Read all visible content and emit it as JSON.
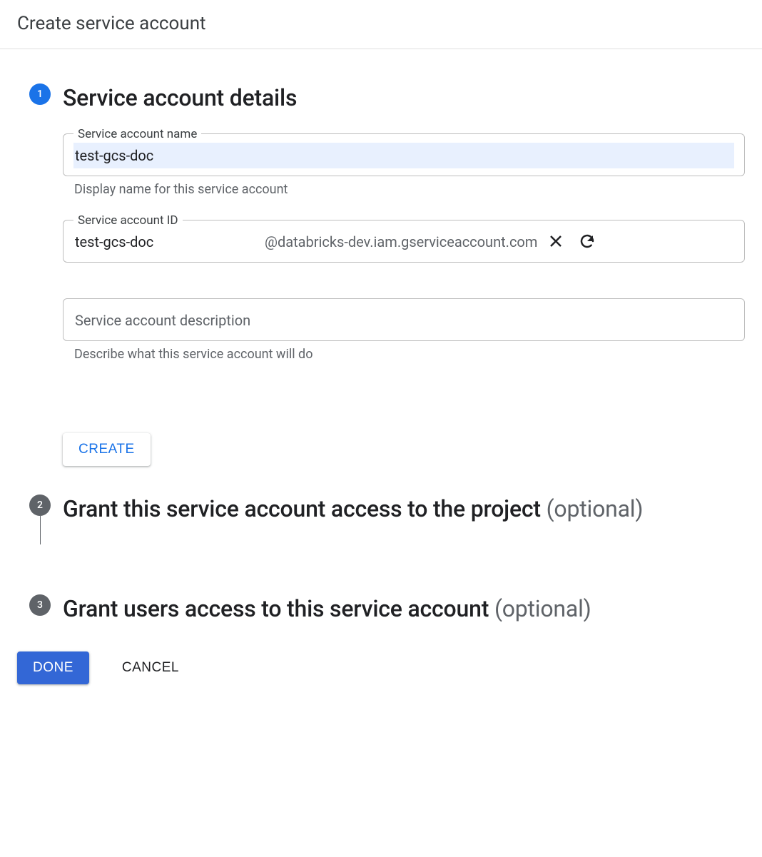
{
  "page": {
    "title": "Create service account"
  },
  "steps": {
    "s1": {
      "number": "1",
      "heading": "Service account details",
      "name_field": {
        "label": "Service account name",
        "value": "test-gcs-doc",
        "helper": "Display name for this service account"
      },
      "id_field": {
        "label": "Service account ID",
        "value": "test-gcs-doc",
        "suffix": "@databricks-dev.iam.gserviceaccount.com"
      },
      "desc_field": {
        "placeholder": "Service account description",
        "value": "",
        "helper": "Describe what this service account will do"
      },
      "create_label": "CREATE"
    },
    "s2": {
      "number": "2",
      "heading_main": "Grant this service account access to the project",
      "heading_optional": "(optional)"
    },
    "s3": {
      "number": "3",
      "heading_main": "Grant users access to this service account",
      "heading_optional": "(optional)"
    }
  },
  "footer": {
    "done_label": "DONE",
    "cancel_label": "CANCEL"
  }
}
